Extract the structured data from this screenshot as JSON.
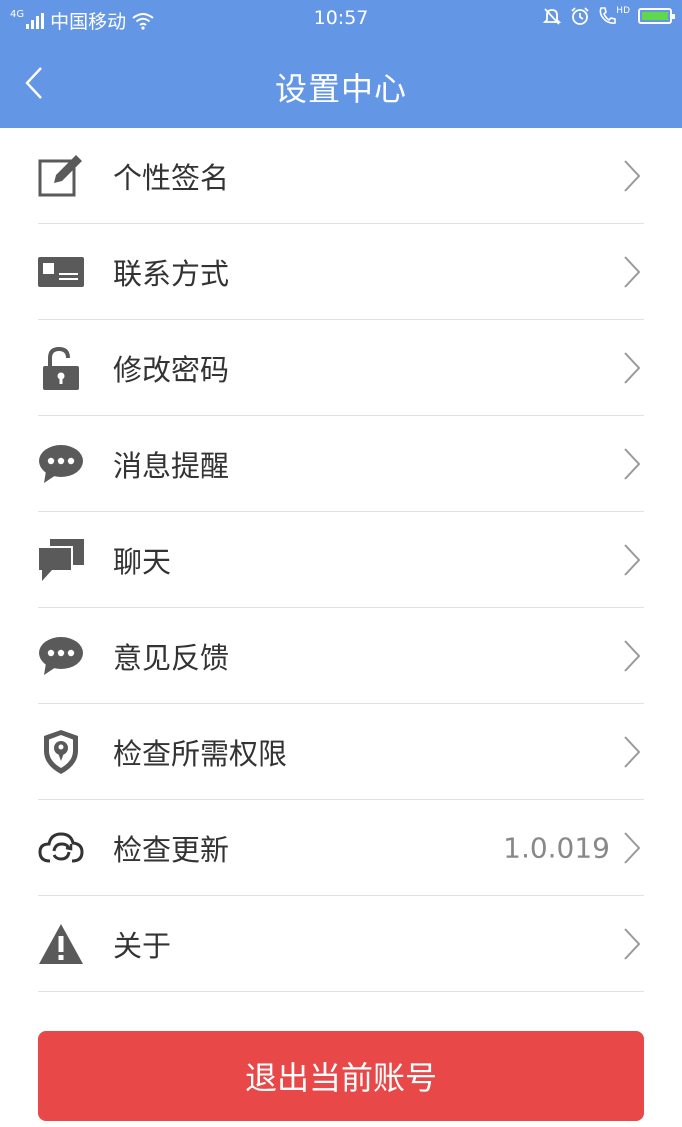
{
  "status_bar": {
    "network": "4G",
    "carrier": "中国移动",
    "time": "10:57",
    "hd": "HD",
    "icons": [
      "signal-icon",
      "wifi-icon",
      "mute-bell-icon",
      "alarm-icon",
      "call-icon",
      "battery-icon"
    ]
  },
  "nav": {
    "title": "设置中心",
    "back_icon": "back-chevron-icon"
  },
  "menu": [
    {
      "label": "个性签名",
      "icon": "edit-icon",
      "value": ""
    },
    {
      "label": "联系方式",
      "icon": "contact-card-icon",
      "value": ""
    },
    {
      "label": "修改密码",
      "icon": "unlock-icon",
      "value": ""
    },
    {
      "label": "消息提醒",
      "icon": "message-bubble-icon",
      "value": ""
    },
    {
      "label": "聊天",
      "icon": "chat-icon",
      "value": ""
    },
    {
      "label": "意见反馈",
      "icon": "feedback-bubble-icon",
      "value": ""
    },
    {
      "label": "检查所需权限",
      "icon": "shield-icon",
      "value": ""
    },
    {
      "label": "检查更新",
      "icon": "cloud-refresh-icon",
      "value": "1.0.019"
    },
    {
      "label": "关于",
      "icon": "warning-icon",
      "value": ""
    }
  ],
  "logout": {
    "label": "退出当前账号"
  },
  "colors": {
    "header": "#6496e6",
    "logout": "#e84848",
    "icon": "#5a5a5a"
  }
}
